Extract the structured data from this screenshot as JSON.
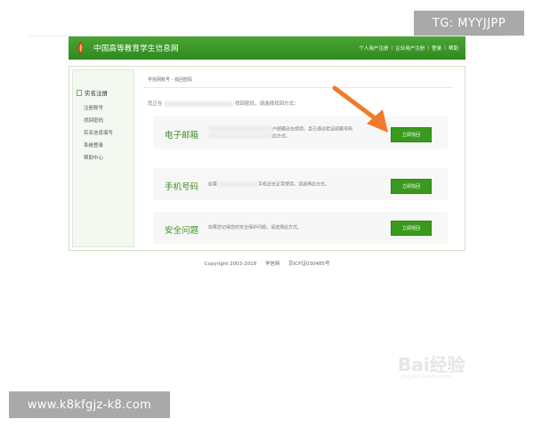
{
  "header": {
    "site_title": "中国高等教育学生信息网",
    "nav": [
      "个人用户注册",
      "企业用户注册",
      "登录",
      "帮助"
    ],
    "nav_separator": "|"
  },
  "sidebar": {
    "heading": "实名注册",
    "items": [
      "注册账号",
      "找回密码",
      "实名信息填写",
      "系统登录",
      "帮助中心"
    ]
  },
  "content": {
    "breadcrumb": "学信网账号 - 找回密码",
    "intro_start": "您正在",
    "intro_end": "找回密码，请选择找回方式：",
    "options": [
      {
        "title": "电子邮箱",
        "desc_line1": "户邮箱还在使用，且已通过验证邮箱号码",
        "desc_line2": "此方式。",
        "button": "立即找回"
      },
      {
        "title": "手机号码",
        "desc_start": "如果",
        "desc_end": "手机还在正常使用，请选择此方式。",
        "button": "立即找回"
      },
      {
        "title": "安全问题",
        "desc": "如果您记得您的安全保护问题，请选择此方式。",
        "button": "立即找回"
      }
    ]
  },
  "footer": {
    "copyright": "Copyright 2003-2018",
    "site": "学信网",
    "icp": "京ICP证030485号"
  },
  "overlays": {
    "tg": "TG: MYYJJPP",
    "site_url": "www.k8kfgjz-k8.com",
    "watermark": "Bai经验",
    "watermark_sub": "jingyan.baidu.com"
  },
  "colors": {
    "header_green": "#3a9a24",
    "button_green": "#3a9a1e",
    "title_green": "#3d8f1f",
    "arrow_orange": "#f07a2a"
  }
}
